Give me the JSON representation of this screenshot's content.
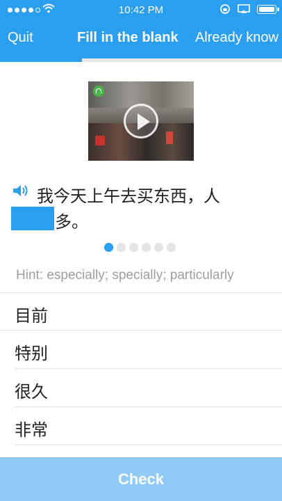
{
  "status_bar": {
    "time": "10:42 PM",
    "icons": [
      "signal-icon",
      "wifi-icon",
      "lock-rotation-icon",
      "airplay-icon",
      "battery-icon"
    ]
  },
  "nav": {
    "quit_label": "Quit",
    "title": "Fill in the blank",
    "already_know_label": "Already know"
  },
  "progress": {
    "fraction": 0.29
  },
  "media": {
    "type": "video",
    "icons": [
      "play-icon",
      "headphones-icon"
    ]
  },
  "exercise": {
    "sentence_line1": "我今天上午去买东西，人",
    "sentence_line2": "多。",
    "speaker_icon": "speaker-icon"
  },
  "pager": {
    "total": 6,
    "active": 0
  },
  "hint": "Hint: especially; specially; particularly",
  "options": [
    {
      "label": "目前"
    },
    {
      "label": "特别"
    },
    {
      "label": "很久"
    },
    {
      "label": "非常"
    }
  ],
  "check_label": "Check",
  "colors": {
    "accent": "#2a9ff0",
    "check_bg": "#8fcbf5",
    "hint": "#9d9d9d"
  }
}
